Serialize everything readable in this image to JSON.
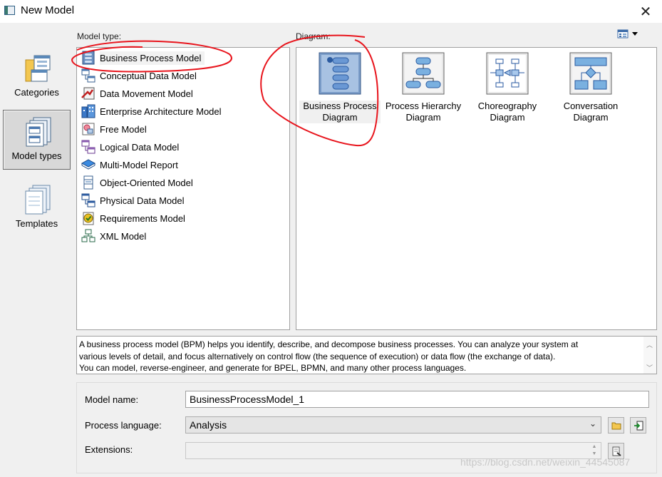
{
  "window": {
    "title": "New Model",
    "close_label": "✕"
  },
  "leftnav": {
    "items": [
      {
        "label": "Categories",
        "icon": "categories-icon",
        "selected": false
      },
      {
        "label": "Model types",
        "icon": "model-types-icon",
        "selected": true
      },
      {
        "label": "Templates",
        "icon": "templates-icon",
        "selected": false
      }
    ]
  },
  "labels": {
    "model_type": "Model type:",
    "diagram": "Diagram:"
  },
  "model_types": [
    {
      "label": "Business Process Model",
      "icon": "business-process-model-icon",
      "selected": true
    },
    {
      "label": "Conceptual Data Model",
      "icon": "conceptual-data-model-icon"
    },
    {
      "label": "Data Movement Model",
      "icon": "data-movement-model-icon"
    },
    {
      "label": "Enterprise Architecture Model",
      "icon": "enterprise-architecture-model-icon"
    },
    {
      "label": "Free Model",
      "icon": "free-model-icon"
    },
    {
      "label": "Logical Data Model",
      "icon": "logical-data-model-icon"
    },
    {
      "label": "Multi-Model Report",
      "icon": "multi-model-report-icon"
    },
    {
      "label": "Object-Oriented Model",
      "icon": "object-oriented-model-icon"
    },
    {
      "label": "Physical Data Model",
      "icon": "physical-data-model-icon"
    },
    {
      "label": "Requirements Model",
      "icon": "requirements-model-icon"
    },
    {
      "label": "XML Model",
      "icon": "xml-model-icon"
    }
  ],
  "diagrams": [
    {
      "line1": "Business Process",
      "line2": "Diagram",
      "icon": "business-process-diagram-icon",
      "selected": true
    },
    {
      "line1": "Process Hierarchy",
      "line2": "Diagram",
      "icon": "process-hierarchy-diagram-icon"
    },
    {
      "line1": "Choreography",
      "line2": "Diagram",
      "icon": "choreography-diagram-icon"
    },
    {
      "line1": "Conversation",
      "line2": "Diagram",
      "icon": "conversation-diagram-icon"
    }
  ],
  "description": {
    "line1": "A business process model (BPM) helps you identify, describe, and decompose business processes. You can analyze your system at",
    "line2": "various levels of detail, and focus alternatively on control flow (the sequence of execution) or data flow (the exchange of data).",
    "line3": "You can model, reverse-engineer, and generate for BPEL, BPMN, and many other process languages."
  },
  "form": {
    "model_name_label": "Model name:",
    "model_name_value": "BusinessProcessModel_1",
    "process_language_label": "Process language:",
    "process_language_value": "Analysis",
    "extensions_label": "Extensions:",
    "extensions_value": ""
  },
  "watermark": "https://blog.csdn.net/weixin_44545087",
  "colors": {
    "annotation_red": "#e8141c",
    "selection_border": "#6a6a6a",
    "panel_border": "#a0a0a0"
  }
}
